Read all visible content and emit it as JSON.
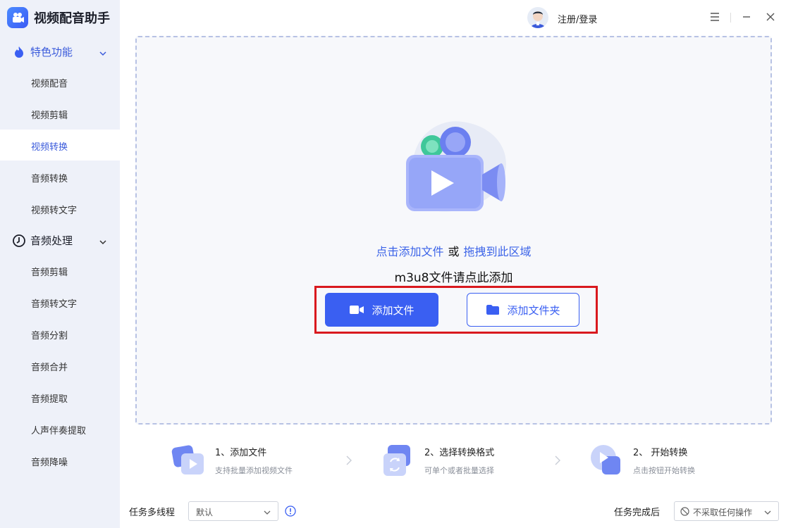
{
  "app": {
    "title": "视频配音助手"
  },
  "header": {
    "login_label": "注册/登录"
  },
  "sidebar": {
    "groups": [
      {
        "label": "特色功能",
        "items": [
          "视频配音",
          "视频剪辑",
          "视频转换",
          "音频转换",
          "视频转文字"
        ]
      },
      {
        "label": "音频处理",
        "items": [
          "音频剪辑",
          "音频转文字",
          "音频分割",
          "音频合并",
          "音频提取",
          "人声伴奏提取",
          "音频降噪"
        ]
      }
    ],
    "active_item": "视频转换"
  },
  "dropzone": {
    "click_text": "点击添加文件",
    "or_text": "或",
    "drag_text": "拖拽到此区域",
    "m3u8_text": "m3u8文件请点此添加",
    "add_file_label": "添加文件",
    "add_folder_label": "添加文件夹"
  },
  "steps": [
    {
      "title": "1、添加文件",
      "desc": "支持批量添加视频文件"
    },
    {
      "title": "2、选择转换格式",
      "desc": "可单个或者批量选择"
    },
    {
      "title": "2、 开始转换",
      "desc": "点击按钮开始转换"
    }
  ],
  "bottom": {
    "thread_label": "任务多线程",
    "thread_value": "默认",
    "after_label": "任务完成后",
    "after_value": "不采取任何操作"
  },
  "colors": {
    "accent": "#3a5ff2",
    "highlight": "#d9191e",
    "sidebar_bg": "#eef1f9"
  }
}
